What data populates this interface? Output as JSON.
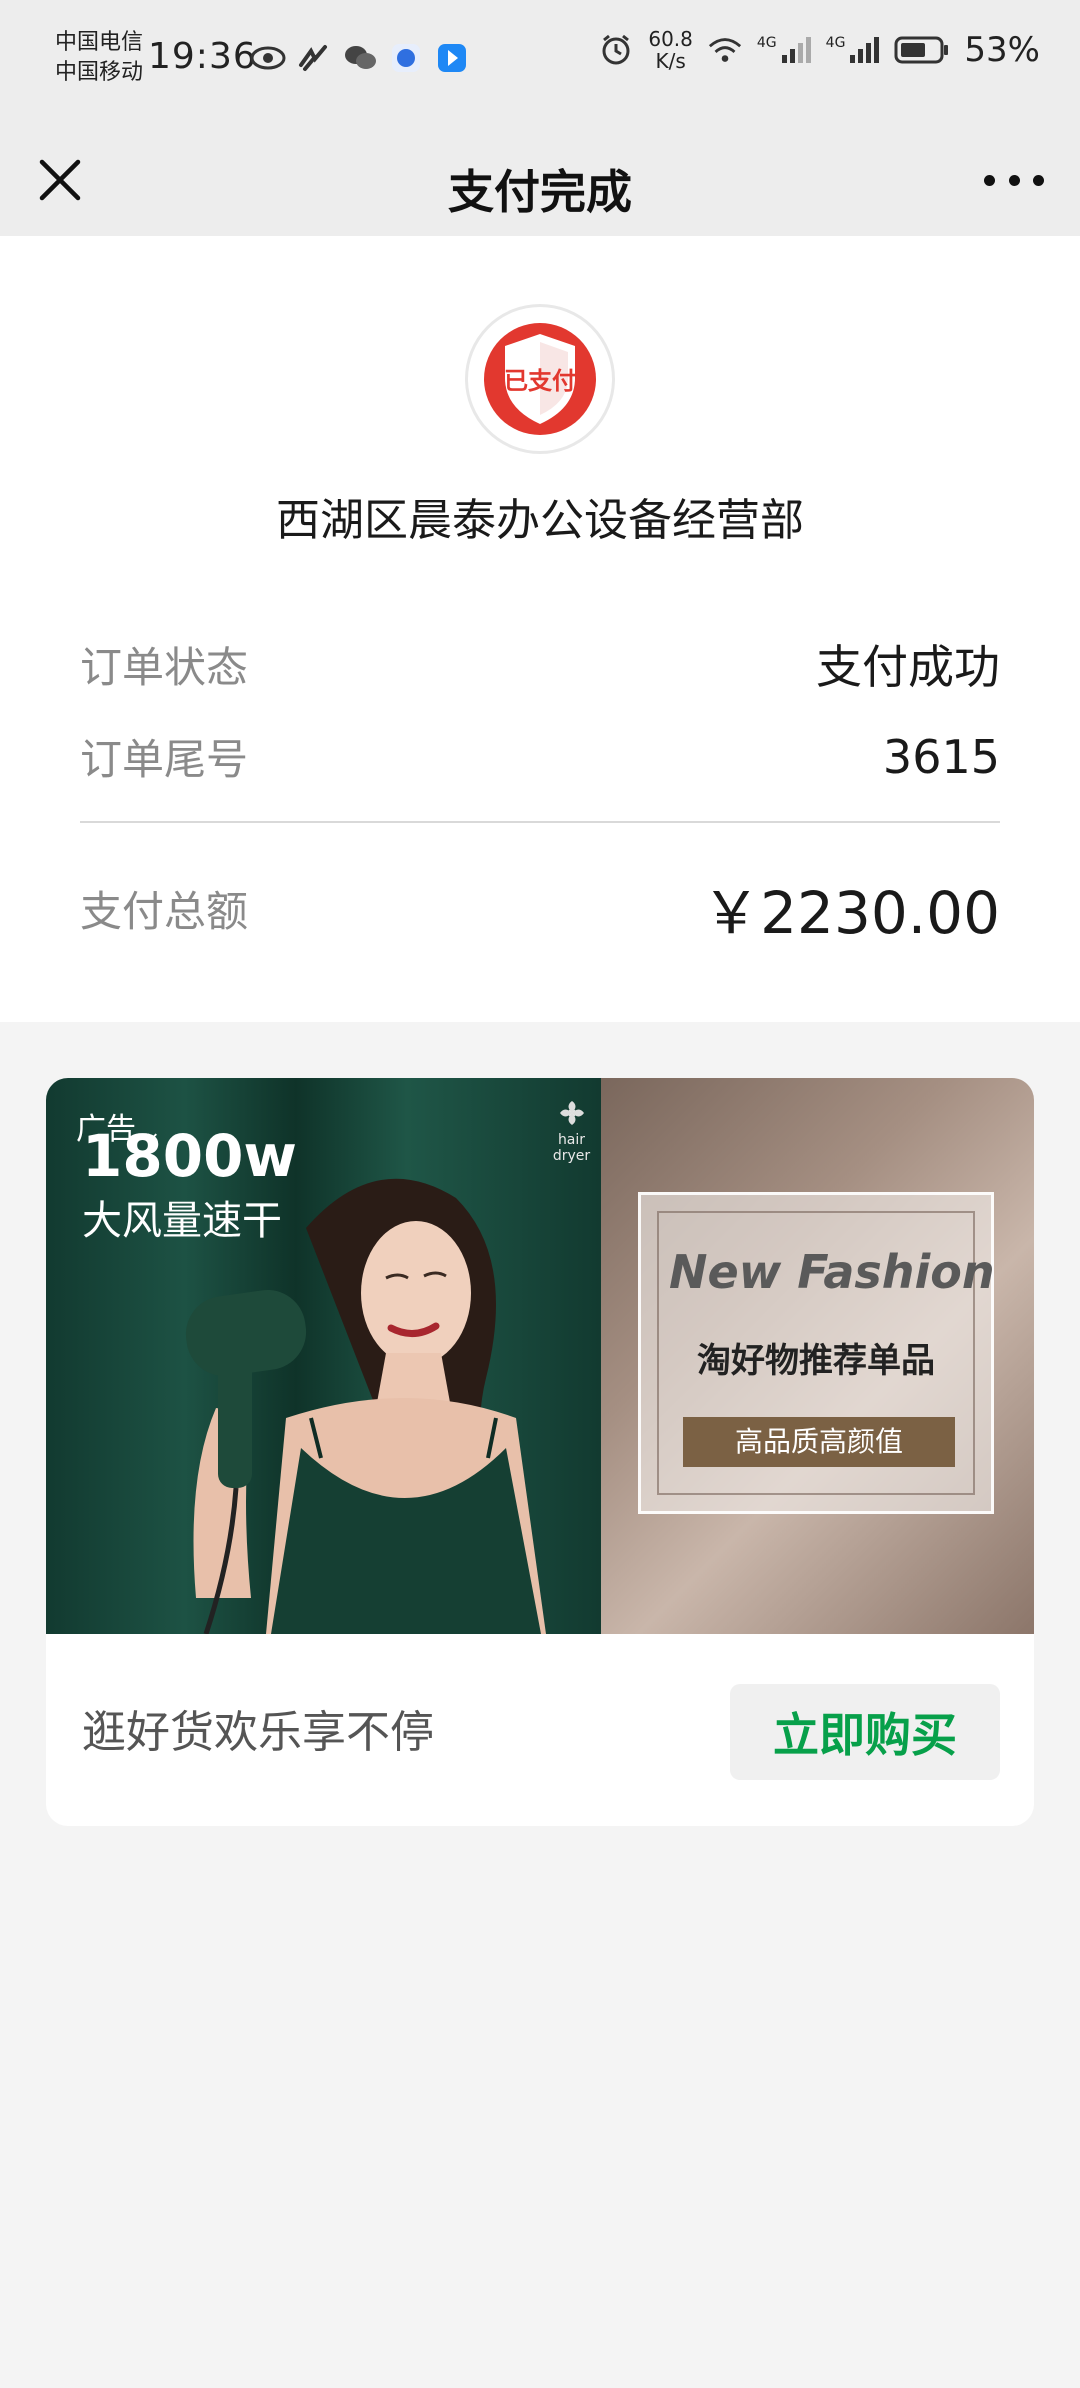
{
  "status_bar": {
    "carrier1": "中国电信",
    "carrier2": "中国移动",
    "time": "19:36",
    "net_speed_value": "60.8",
    "net_speed_unit": "K/s",
    "signal1_label": "4G",
    "signal2_label": "4G",
    "battery": "53%"
  },
  "navbar": {
    "title": "支付完成"
  },
  "payment": {
    "badge_text": "已支付",
    "merchant": "西湖区晨泰办公设备经营部",
    "rows": [
      {
        "label": "订单状态",
        "value": "支付成功"
      },
      {
        "label": "订单尾号",
        "value": "3615"
      }
    ],
    "total_label": "支付总额",
    "total_value": "￥2230.00"
  },
  "ad": {
    "tag": "广告",
    "watt": "1800w",
    "slogan": "大风量速干",
    "logo_text": "hair dryer",
    "fashion": "New Fashion",
    "recommend": "淘好物推荐单品",
    "pill": "高品质高颜值",
    "caption": "逛好货欢乐享不停",
    "buy_button": "立即购买"
  },
  "colors": {
    "accent_green": "#07a04a",
    "badge_red": "#e2382f",
    "background": "#f4f4f4"
  }
}
